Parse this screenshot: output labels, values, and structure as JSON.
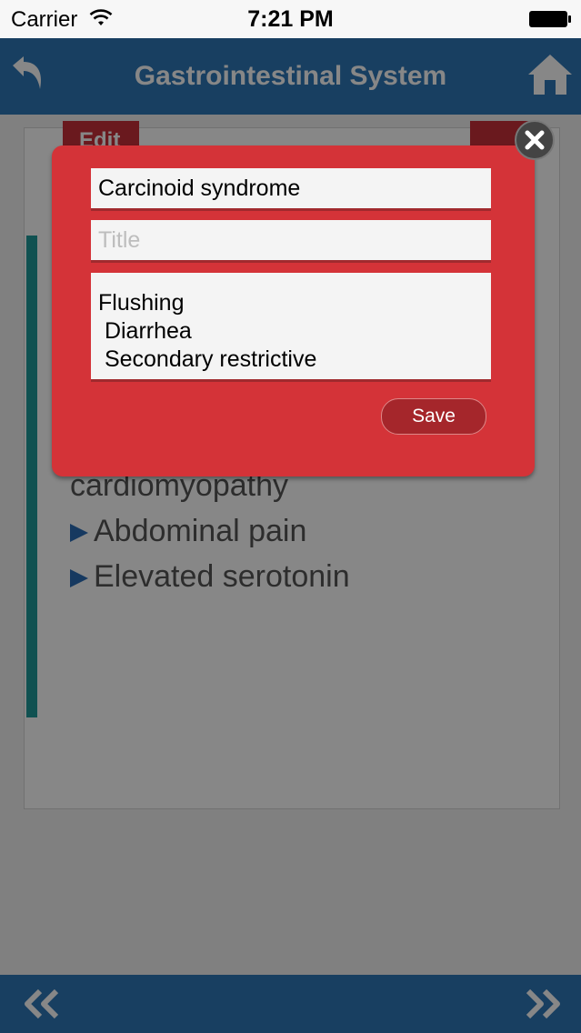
{
  "status_bar": {
    "carrier": "Carrier",
    "time": "7:21 PM"
  },
  "nav": {
    "title": "Gastrointestinal System"
  },
  "card": {
    "tab_left_label": "Edit",
    "lines": [
      {
        "text": "cardiomyopathy",
        "bullet": false
      },
      {
        "text": "Abdominal pain",
        "bullet": true
      },
      {
        "text": "Elevated serotonin",
        "bullet": true
      }
    ]
  },
  "dialog": {
    "name_value": "Carcinoid syndrome",
    "title_value": "",
    "title_placeholder": "Title",
    "notes_value": "Flushing\n Diarrhea\n Secondary restrictive",
    "save_label": "Save"
  },
  "colors": {
    "nav_blue": "#2e78b8",
    "dialog_red": "#d43338",
    "save_red": "#a5262b",
    "accent_teal": "#1f9a9a"
  }
}
